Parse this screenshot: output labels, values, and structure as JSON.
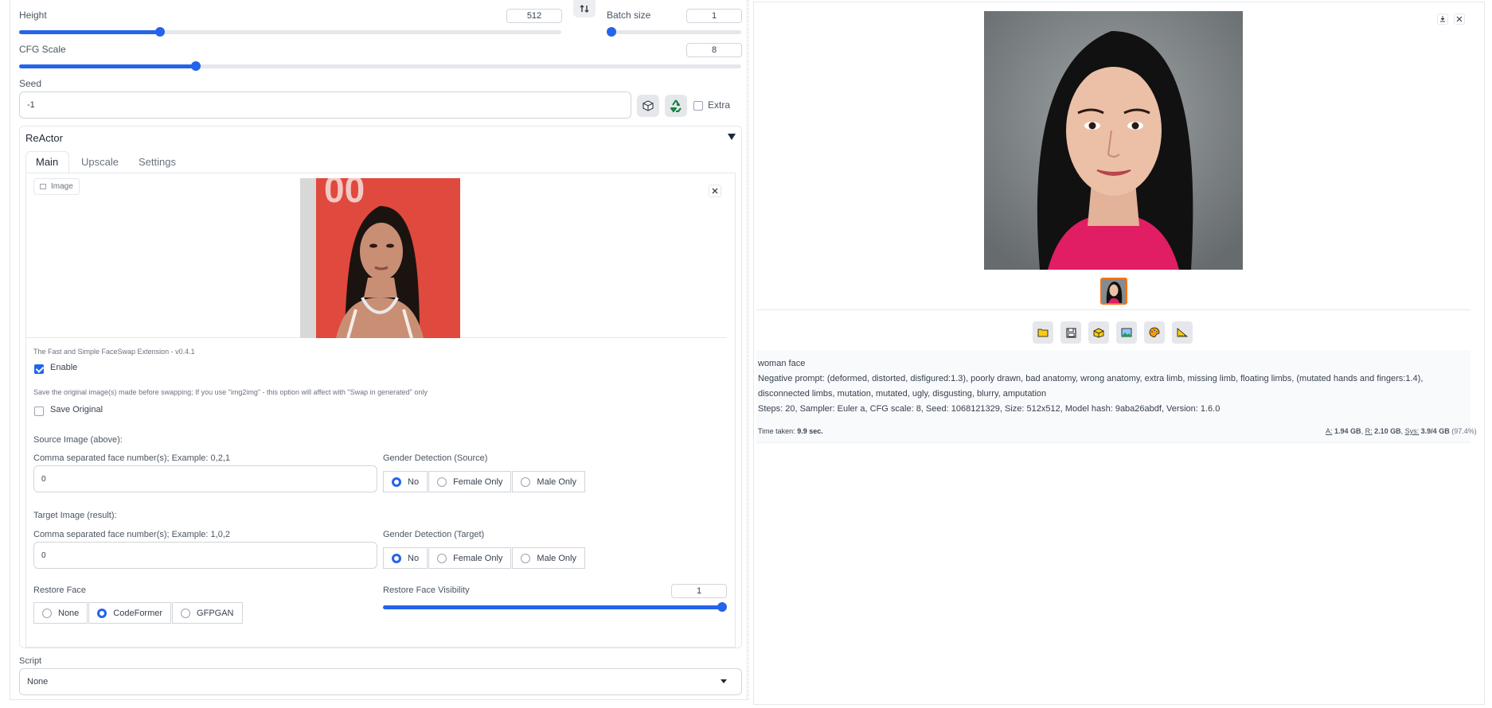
{
  "controls": {
    "height_label": "Height",
    "height_value": "512",
    "height_fraction": 0.26,
    "batch_label": "Batch size",
    "batch_value": "1",
    "cfg_label": "CFG Scale",
    "cfg_value": "8",
    "cfg_fraction": 0.245,
    "seed_label": "Seed",
    "seed_value": "-1",
    "extra_label": "Extra"
  },
  "reactor": {
    "title": "ReActor",
    "tabs": [
      "Main",
      "Upscale",
      "Settings"
    ],
    "image_label": "Image",
    "version_text": "The Fast and Simple FaceSwap Extension - v0.4.1",
    "enable_label": "Enable",
    "save_note": "Save the original image(s) made before swapping; If you use \"img2img\" - this option will affect with \"Swap in generated\" only",
    "save_original_label": "Save Original",
    "source_heading": "Source Image (above):",
    "source_faces_label": "Comma separated face number(s); Example: 0,2,1",
    "source_faces_value": "0",
    "gender_source_label": "Gender Detection (Source)",
    "target_heading": "Target Image (result):",
    "target_faces_label": "Comma separated face number(s); Example: 1,0,2",
    "target_faces_value": "0",
    "gender_target_label": "Gender Detection (Target)",
    "gender_options": [
      "No",
      "Female Only",
      "Male Only"
    ],
    "restore_face_label": "Restore Face",
    "restore_options": [
      "None",
      "CodeFormer",
      "GFPGAN"
    ],
    "visibility_label": "Restore Face Visibility",
    "visibility_value": "1",
    "visibility_fraction": 1.0
  },
  "script": {
    "label": "Script",
    "selected": "None"
  },
  "output": {
    "prompt": "woman face",
    "negative": "Negative prompt: (deformed, distorted, disfigured:1.3), poorly drawn, bad anatomy, wrong anatomy, extra limb, missing limb, floating limbs, (mutated hands and fingers:1.4),",
    "negative2": "disconnected limbs, mutation, mutated, ugly, disgusting, blurry, amputation",
    "params": "Steps: 20, Sampler: Euler a, CFG scale: 8, Seed: 1068121329, Size: 512x512, Model hash: 9aba26abdf, Version: 1.6.0",
    "time_label": "Time taken:",
    "time_value": "9.9 sec.",
    "mem_a_label": "A:",
    "mem_a": "1.94 GB",
    "mem_r_label": "R:",
    "mem_r": "2.10 GB",
    "mem_sys_label": "Sys:",
    "mem_sys": "3.9/4 GB",
    "mem_pct": "(97.4%)"
  },
  "colors": {
    "accent": "#2563eb",
    "thumb_border": "#f97316",
    "source_bg": "#e5473a"
  },
  "icons": {
    "swap": "swap-icon",
    "dice": "dice-icon",
    "recycle": "recycle-icon",
    "collapse": "triangle-down-icon",
    "close": "close-icon",
    "download": "download-icon",
    "tools": [
      "folder-icon",
      "save-icon",
      "zip-icon",
      "image-icon",
      "palette-icon",
      "ruler-icon"
    ]
  }
}
